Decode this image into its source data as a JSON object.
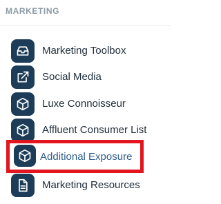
{
  "sidebar": {
    "section_title": "MARKETING",
    "items": [
      {
        "label": "Marketing Toolbox",
        "icon": "inbox-tray-icon"
      },
      {
        "label": "Social Media",
        "icon": "external-link-icon"
      },
      {
        "label": "Luxe Connoisseur",
        "icon": "cube-icon"
      },
      {
        "label": "Affluent Consumer List",
        "icon": "cube-icon"
      },
      {
        "label": "Additional Exposure",
        "icon": "cube-icon",
        "highlighted": true
      },
      {
        "label": "Marketing Resources",
        "icon": "document-icon"
      }
    ]
  },
  "colors": {
    "icon_bg": "#1d3c57",
    "active_text": "#2f5d8c",
    "highlight_border": "#e3161f",
    "header_text": "#8b9aa5"
  }
}
